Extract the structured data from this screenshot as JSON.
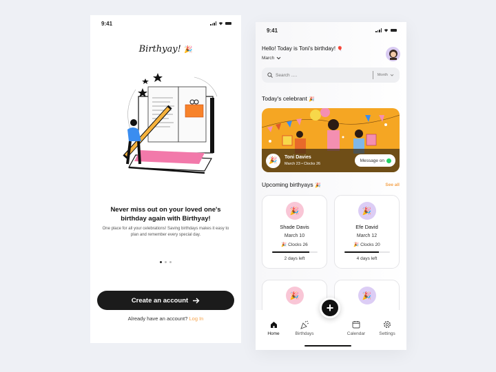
{
  "onboarding": {
    "status_time": "9:41",
    "brand": "Birthyay!",
    "brand_emoji": "🎉",
    "illustration": "person-with-pencil-and-laptop",
    "headline": "Never miss out on your loved one's birthday again with Birthyay!",
    "subtext": "One place for all your celebrations! Saving birthdays makes it easy to plan and remember every special day.",
    "pagination": {
      "total": 3,
      "active": 0
    },
    "cta_label": "Create an account",
    "cta_icon": "arrow-right-icon",
    "login_prompt": "Already have an account?",
    "login_link": "Log In",
    "accent_color": "#f5a34b"
  },
  "home": {
    "status_time": "9:41",
    "greeting": "Hello! Today is Toni's birthday!",
    "greeting_emoji": "🎈",
    "month_selector": "March",
    "search": {
      "placeholder": "Search .....",
      "filter_value": "Month"
    },
    "today_section": {
      "title": "Today's celebrant",
      "emoji": "🎉"
    },
    "celebrant": {
      "name": "Toni Davies",
      "meta": "March 23 • Clocks 26",
      "message_button": "Message on",
      "banner_color": "#f5a623"
    },
    "upcoming_section": {
      "title": "Upcoming birthyays",
      "emoji": "🎉",
      "see_all": "See all"
    },
    "upcoming": [
      {
        "name": "Shade Davis",
        "date": "March 10",
        "clocks": "Clocks 26",
        "days_left": "2 days left",
        "progress": 0.82,
        "color": "#f9c6d6"
      },
      {
        "name": "Efe David",
        "date": "March 12",
        "clocks": "Clocks 20",
        "days_left": "4 days left",
        "progress": 0.76,
        "color": "#dccdf5"
      },
      {
        "color": "#f9c6d6"
      },
      {
        "color": "#dccdf5"
      }
    ],
    "tabs": [
      {
        "label": "Home",
        "icon": "home-icon",
        "active": true
      },
      {
        "label": "Birthdays",
        "icon": "party-popper-icon",
        "active": false
      },
      {
        "label": "Calendar",
        "icon": "calendar-icon",
        "active": false
      },
      {
        "label": "Settings",
        "icon": "gear-icon",
        "active": false
      }
    ],
    "fab_label": "+"
  }
}
